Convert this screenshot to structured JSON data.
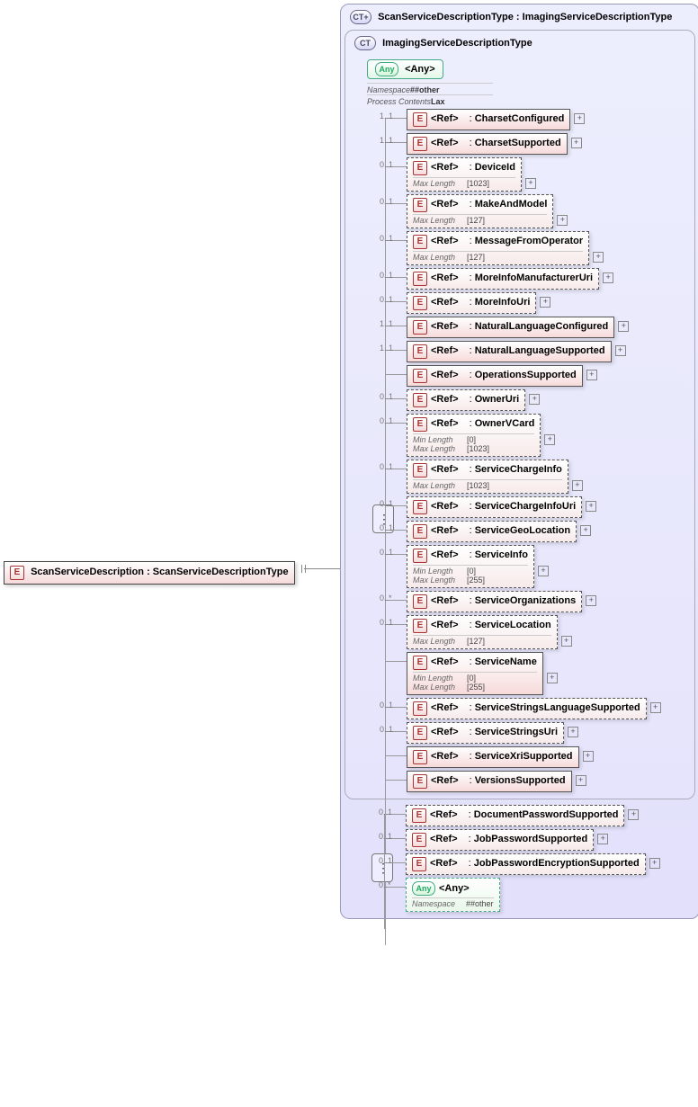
{
  "root": {
    "label": "ScanServiceDescription : ScanServiceDescriptionType"
  },
  "outerCT": {
    "label": "ScanServiceDescriptionType : ImagingServiceDescriptionType"
  },
  "innerCT": {
    "label": "ImagingServiceDescriptionType"
  },
  "anyTop": {
    "label": "<Any>",
    "ns_k": "Namespace",
    "ns_v": "##other",
    "pc_k": "Process Contents",
    "pc_v": "Lax"
  },
  "badges": {
    "e": "E",
    "any": "Any",
    "ct": "CT",
    "ctplus": "CT+"
  },
  "tokens": {
    "ref": "<Ref>",
    "plus": "+"
  },
  "innerItems": [
    {
      "card": "1..1",
      "dashed": false,
      "name": "CharsetConfigured",
      "plus": true
    },
    {
      "card": "1..1",
      "dashed": false,
      "name": "CharsetSupported",
      "plus": true
    },
    {
      "card": "0..1",
      "dashed": true,
      "name": "DeviceId",
      "plus": true,
      "props": [
        {
          "k": "Max Length",
          "v": "[1023]"
        }
      ]
    },
    {
      "card": "0..1",
      "dashed": true,
      "name": "MakeAndModel",
      "plus": true,
      "props": [
        {
          "k": "Max Length",
          "v": "[127]"
        }
      ]
    },
    {
      "card": "0..1",
      "dashed": true,
      "name": "MessageFromOperator",
      "plus": true,
      "props": [
        {
          "k": "Max Length",
          "v": "[127]"
        }
      ]
    },
    {
      "card": "0..1",
      "dashed": true,
      "name": "MoreInfoManufacturerUri",
      "plus": true
    },
    {
      "card": "0..1",
      "dashed": true,
      "name": "MoreInfoUri",
      "plus": true
    },
    {
      "card": "1..1",
      "dashed": false,
      "name": "NaturalLanguageConfigured",
      "plus": true
    },
    {
      "card": "1..1",
      "dashed": false,
      "name": "NaturalLanguageSupported",
      "plus": true
    },
    {
      "card": "",
      "dashed": false,
      "name": "OperationsSupported",
      "plus": true
    },
    {
      "card": "0..1",
      "dashed": true,
      "name": "OwnerUri",
      "plus": true
    },
    {
      "card": "0..1",
      "dashed": true,
      "name": "OwnerVCard",
      "plus": true,
      "props": [
        {
          "k": "Min Length",
          "v": "[0]"
        },
        {
          "k": "Max Length",
          "v": "[1023]"
        }
      ]
    },
    {
      "card": "0..1",
      "dashed": true,
      "name": "ServiceChargeInfo",
      "plus": true,
      "props": [
        {
          "k": "Max Length",
          "v": "[1023]"
        }
      ]
    },
    {
      "card": "0..1",
      "dashed": true,
      "name": "ServiceChargeInfoUri",
      "plus": true
    },
    {
      "card": "0..1",
      "dashed": true,
      "name": "ServiceGeoLocation",
      "plus": true
    },
    {
      "card": "0..1",
      "dashed": true,
      "name": "ServiceInfo",
      "plus": true,
      "props": [
        {
          "k": "Min Length",
          "v": "[0]"
        },
        {
          "k": "Max Length",
          "v": "[255]"
        }
      ]
    },
    {
      "card": "0..*",
      "dashed": true,
      "name": "ServiceOrganizations",
      "plus": true
    },
    {
      "card": "0..1",
      "dashed": true,
      "name": "ServiceLocation",
      "plus": true,
      "props": [
        {
          "k": "Max Length",
          "v": "[127]"
        }
      ]
    },
    {
      "card": "",
      "dashed": false,
      "name": "ServiceName",
      "plus": true,
      "props": [
        {
          "k": "Min Length",
          "v": "[0]"
        },
        {
          "k": "Max Length",
          "v": "[255]"
        }
      ]
    },
    {
      "card": "0..1",
      "dashed": true,
      "name": "ServiceStringsLanguageSupported",
      "plus": true
    },
    {
      "card": "0..1",
      "dashed": true,
      "name": "ServiceStringsUri",
      "plus": true
    },
    {
      "card": "",
      "dashed": false,
      "name": "ServiceXriSupported",
      "plus": true
    },
    {
      "card": "",
      "dashed": false,
      "name": "VersionsSupported",
      "plus": true
    }
  ],
  "outerItems": [
    {
      "card": "0..1",
      "dashed": true,
      "name": "DocumentPasswordSupported",
      "plus": true
    },
    {
      "card": "0..1",
      "dashed": true,
      "name": "JobPasswordSupported",
      "plus": true
    },
    {
      "card": "0..1",
      "dashed": true,
      "name": "JobPasswordEncryptionSupported",
      "plus": true
    }
  ],
  "anyBottom": {
    "card": "0..*",
    "label": "<Any>",
    "ns_k": "Namespace",
    "ns_v": "##other"
  }
}
